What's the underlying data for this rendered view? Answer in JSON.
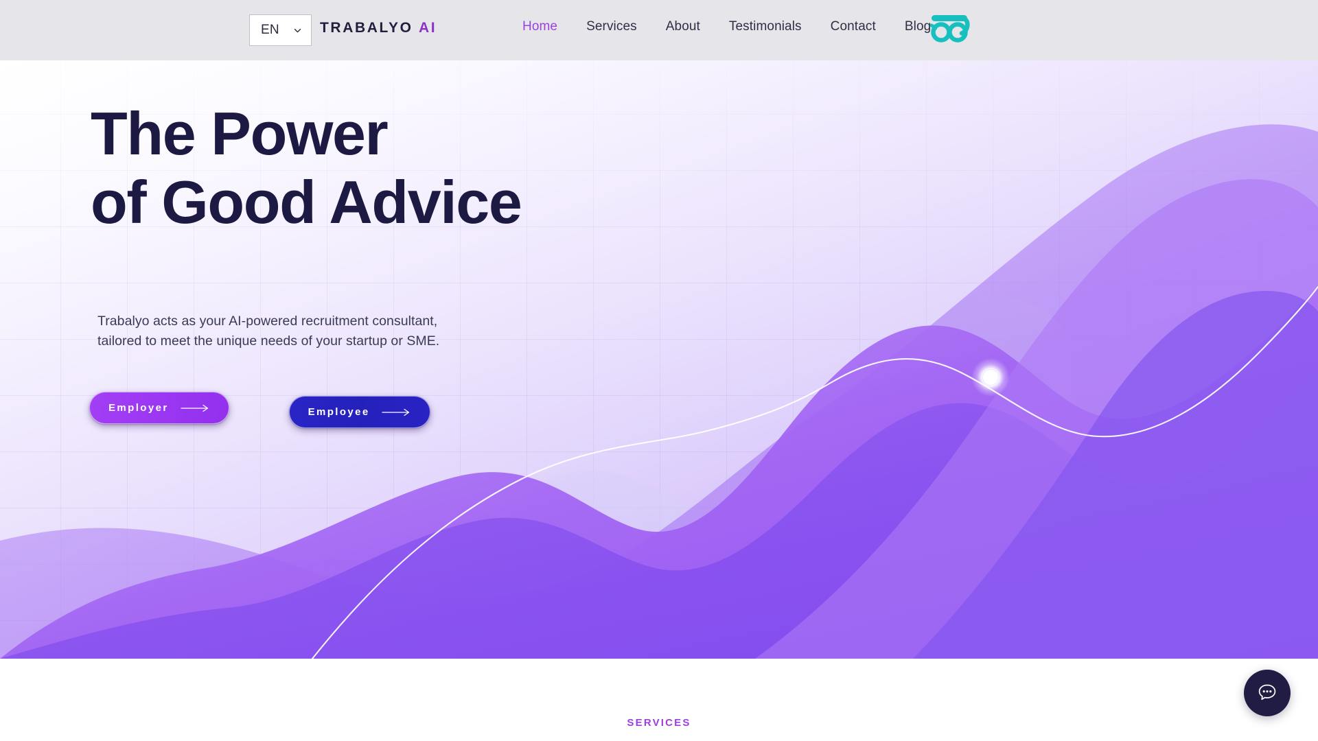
{
  "header": {
    "language_selector": {
      "value": "EN",
      "icon": "chevron-down-icon"
    },
    "brand": {
      "name": "TRABALYO",
      "suffix": "AI"
    },
    "nav_items": [
      {
        "label": "Home",
        "active": true
      },
      {
        "label": "Services",
        "active": false
      },
      {
        "label": "About",
        "active": false
      },
      {
        "label": "Testimonials",
        "active": false
      },
      {
        "label": "Contact",
        "active": false
      },
      {
        "label": "Blog",
        "active": false
      }
    ],
    "logo": {
      "icon": "trabalyo-glasses-logo-icon",
      "color": "#18bfbf"
    },
    "background_color": "#e6e5ea"
  },
  "hero": {
    "headline": "The Power\nof Good Advice",
    "subhead": "Trabalyo acts as your AI-powered recruitment consultant,\ntailored to meet the unique needs of your startup or SME.",
    "headline_color": "#1c1942",
    "buttons": [
      {
        "label": "Employer",
        "icon": "arrow-right-icon",
        "color": "#9c38f2"
      },
      {
        "label": "Employee",
        "icon": "arrow-right-icon",
        "color": "#2421bb"
      }
    ],
    "graphic": {
      "type": "decorative-wave-chart",
      "marker": {
        "icon": "data-point-marker",
        "color": "#ffffff"
      },
      "wave_colors": [
        "#b58cf5",
        "#a86df3",
        "#8a5cf0",
        "#7b4ded"
      ],
      "line_color": "#ffffff"
    }
  },
  "services_section": {
    "eyebrow": "SERVICES",
    "eyebrow_color": "#9b3fe0"
  },
  "chat_widget": {
    "icon": "chat-bubble-icon",
    "background_color": "#201c44"
  }
}
